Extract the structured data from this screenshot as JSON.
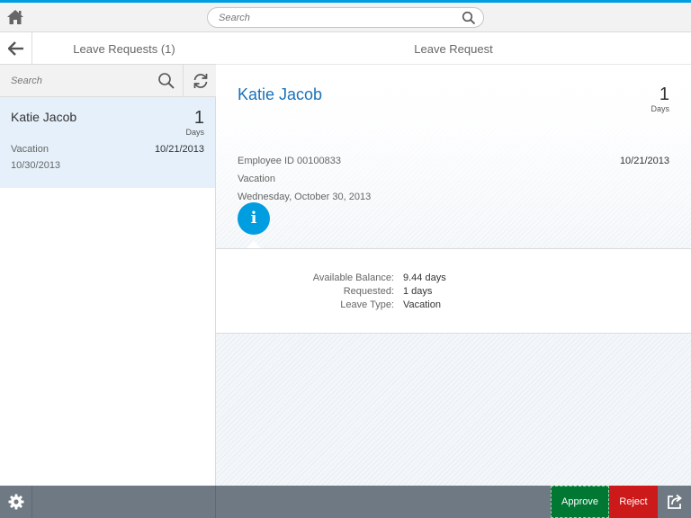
{
  "shell": {
    "search_placeholder": "Search"
  },
  "master": {
    "title": "Leave Requests (1)",
    "search_placeholder": "Search",
    "items": [
      {
        "name": "Katie Jacob",
        "number": "1",
        "unit": "Days",
        "type": "Vacation",
        "request_date": "10/21/2013",
        "leave_date": "10/30/2013"
      }
    ]
  },
  "detail": {
    "title": "Leave Request",
    "name": "Katie Jacob",
    "number": "1",
    "unit": "Days",
    "employee_id": "Employee ID 00100833",
    "type": "Vacation",
    "long_date": "Wednesday, October 30, 2013",
    "request_date": "10/21/2013",
    "info_tab_glyph": "i",
    "form": [
      {
        "label": "Available Balance:",
        "value": "9.44 days"
      },
      {
        "label": "Requested:",
        "value": "1 days"
      },
      {
        "label": "Leave Type:",
        "value": "Vacation"
      }
    ]
  },
  "footer": {
    "approve_label": "Approve",
    "reject_label": "Reject"
  },
  "colors": {
    "accent": "#009de0",
    "title_blue": "#1b72b8",
    "approve": "#007833",
    "reject": "#cc1919",
    "footer": "#6e7983",
    "selected_item": "#e5f0fa"
  },
  "icons": [
    "home-icon",
    "search-icon",
    "back-arrow-icon",
    "refresh-icon",
    "info-icon",
    "gear-icon",
    "share-icon"
  ]
}
